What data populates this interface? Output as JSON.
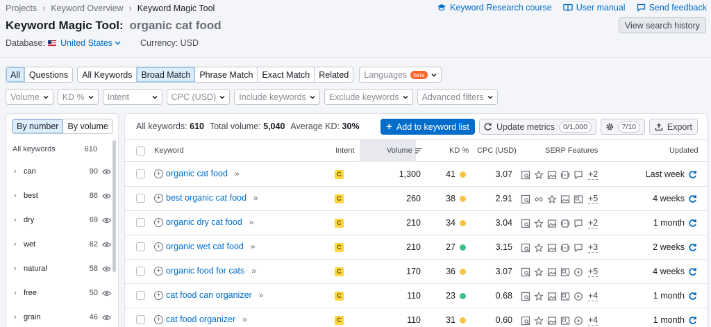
{
  "breadcrumbs": [
    "Projects",
    "Keyword Overview",
    "Keyword Magic Tool"
  ],
  "top_links": {
    "course": "Keyword Research course",
    "manual": "User manual",
    "feedback": "Send feedback"
  },
  "header": {
    "title": "Keyword Magic Tool:",
    "query": "organic cat food",
    "history_button": "View search history",
    "database_label": "Database:",
    "database_value": "United States",
    "currency": "Currency: USD"
  },
  "filters_row1": {
    "all": "All",
    "questions": "Questions",
    "all_keywords": "All Keywords",
    "broad": "Broad Match",
    "phrase": "Phrase Match",
    "exact": "Exact Match",
    "related": "Related",
    "languages": "Languages",
    "beta": "beta"
  },
  "filters_row2": [
    "Volume",
    "KD %",
    "Intent",
    "CPC (USD)",
    "Include keywords",
    "Exclude keywords",
    "Advanced filters"
  ],
  "sidebar": {
    "by_number": "By number",
    "by_volume": "By volume",
    "all_keywords_label": "All keywords",
    "all_keywords_count": "610",
    "groups": [
      {
        "word": "can",
        "count": "90"
      },
      {
        "word": "best",
        "count": "86"
      },
      {
        "word": "dry",
        "count": "69"
      },
      {
        "word": "wet",
        "count": "62"
      },
      {
        "word": "natural",
        "count": "58"
      },
      {
        "word": "free",
        "count": "50"
      },
      {
        "word": "grain",
        "count": "46"
      }
    ]
  },
  "summary": {
    "all_keywords_label": "All keywords:",
    "all_keywords_value": "610",
    "total_volume_label": "Total volume:",
    "total_volume_value": "5,040",
    "avg_kd_label": "Average KD:",
    "avg_kd_value": "30%"
  },
  "actions": {
    "add": "Add to keyword list",
    "update": "Update metrics",
    "update_count": "0/1,000",
    "settings_count": "7/10",
    "export": "Export"
  },
  "columns": {
    "keyword": "Keyword",
    "intent": "Intent",
    "volume": "Volume",
    "kd": "KD %",
    "cpc": "CPC (USD)",
    "serp": "SERP Features",
    "updated": "Updated"
  },
  "colors": {
    "kd_yellow": "#f6c342",
    "kd_green": "#3bc48a",
    "intent_commercial": "#fcd53f",
    "accent": "#006dca"
  },
  "rows": [
    {
      "keyword": "organic cat food",
      "intent": "C",
      "volume": "1,300",
      "kd": "41",
      "kd_color": "#f6c342",
      "cpc": "3.07",
      "more": "+2",
      "updated": "Last week"
    },
    {
      "keyword": "best organic cat food",
      "intent": "C",
      "volume": "260",
      "kd": "38",
      "kd_color": "#f6c342",
      "cpc": "2.91",
      "more": "+5",
      "updated": "4 weeks"
    },
    {
      "keyword": "organic dry cat food",
      "intent": "C",
      "volume": "210",
      "kd": "34",
      "kd_color": "#f6c342",
      "cpc": "3.04",
      "more": "+2",
      "updated": "1 month"
    },
    {
      "keyword": "organic wet cat food",
      "intent": "C",
      "volume": "210",
      "kd": "27",
      "kd_color": "#3bc48a",
      "cpc": "3.15",
      "more": "+3",
      "updated": "2 weeks"
    },
    {
      "keyword": "organic food for cats",
      "intent": "C",
      "volume": "170",
      "kd": "36",
      "kd_color": "#f6c342",
      "cpc": "3.07",
      "more": "+5",
      "updated": "4 weeks"
    },
    {
      "keyword": "cat food can organizer",
      "intent": "C",
      "volume": "110",
      "kd": "23",
      "kd_color": "#3bc48a",
      "cpc": "0.68",
      "more": "+4",
      "updated": "1 month"
    },
    {
      "keyword": "cat food organizer",
      "intent": "C",
      "volume": "110",
      "kd": "31",
      "kd_color": "#f6c342",
      "cpc": "0.60",
      "more": "+4",
      "updated": "1 month"
    }
  ]
}
